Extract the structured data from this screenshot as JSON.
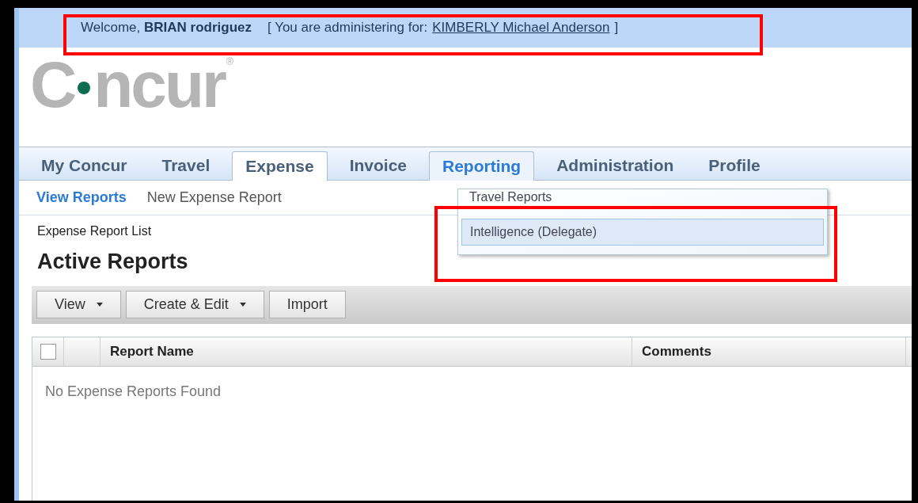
{
  "welcome_bar": {
    "greeting": "Welcome,",
    "user": "BRIAN rodriguez",
    "admin_prefix": "[ You are administering for:",
    "admin_for": "KIMBERLY Michael Anderson",
    "admin_suffix": "]"
  },
  "logo": {
    "first": "C",
    "rest": "ncur",
    "mark": "®"
  },
  "tabs": [
    {
      "label": "My Concur",
      "selected": false,
      "expanded": false
    },
    {
      "label": "Travel",
      "selected": false,
      "expanded": false
    },
    {
      "label": "Expense",
      "selected": true,
      "expanded": false
    },
    {
      "label": "Invoice",
      "selected": false,
      "expanded": false
    },
    {
      "label": "Reporting",
      "selected": false,
      "expanded": true
    },
    {
      "label": "Administration",
      "selected": false,
      "expanded": false
    },
    {
      "label": "Profile",
      "selected": false,
      "expanded": false
    }
  ],
  "dropdown": {
    "items": [
      {
        "label": "Travel Reports",
        "selected": false
      },
      {
        "label": "Intelligence (Delegate)",
        "selected": true
      }
    ]
  },
  "subnav": [
    {
      "label": "View Reports",
      "selected": true
    },
    {
      "label": "New Expense Report",
      "selected": false
    }
  ],
  "breadcrumb": "Expense Report List",
  "heading": "Active Reports",
  "toolbar": [
    {
      "label": "View",
      "kind": "menu"
    },
    {
      "label": "Create & Edit",
      "kind": "menu"
    },
    {
      "label": "Import",
      "kind": "plain"
    }
  ],
  "table": {
    "select_all_checked": false,
    "columns": [
      "Report Name",
      "Comments"
    ],
    "empty_message": "No Expense Reports Found"
  }
}
